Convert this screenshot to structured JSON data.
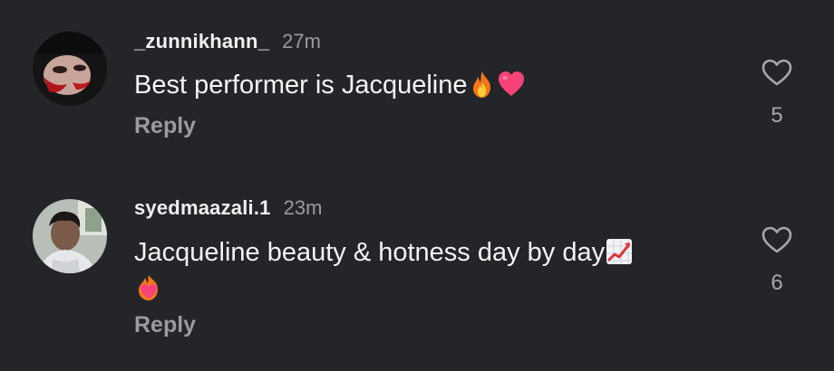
{
  "comments": [
    {
      "username": "_zunnikhann_",
      "time": "27m",
      "text": "Best performer is Jacqueline",
      "emojis": [
        "fire-emoji",
        "pink-heart-emoji"
      ],
      "reply_label": "Reply",
      "like_count": "5",
      "avatar_icon": "avatar-photo"
    },
    {
      "username": "syedmaazali.1",
      "time": "23m",
      "text": "Jacqueline beauty & hotness day by day",
      "emojis": [
        "chart-increasing-emoji",
        "heart-on-fire-emoji"
      ],
      "reply_label": "Reply",
      "like_count": "6",
      "avatar_icon": "avatar-photo"
    }
  ],
  "colors": {
    "background": "#242529",
    "text": "#f4f4f4",
    "muted": "#9a9ba0"
  },
  "icons": {
    "like": "heart-outline-icon"
  }
}
